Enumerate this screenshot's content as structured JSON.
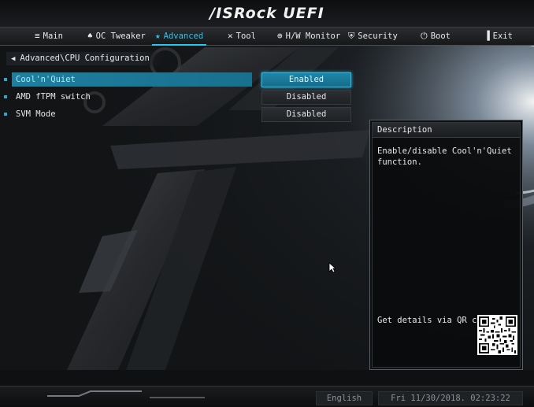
{
  "header": {
    "logo": "/ISRock UEFI"
  },
  "nav": {
    "tabs": [
      {
        "id": "main",
        "label": "Main",
        "icon": "list-icon",
        "glyph": "≡"
      },
      {
        "id": "oc",
        "label": "OC Tweaker",
        "icon": "rocket-icon",
        "glyph": "♠"
      },
      {
        "id": "advanced",
        "label": "Advanced",
        "icon": "star-icon",
        "glyph": "★"
      },
      {
        "id": "tool",
        "label": "Tool",
        "icon": "tools-icon",
        "glyph": "✕"
      },
      {
        "id": "hw",
        "label": "H/W Monitor",
        "icon": "monitor-icon",
        "glyph": "⊕"
      },
      {
        "id": "security",
        "label": "Security",
        "icon": "shield-icon",
        "glyph": "⛨"
      },
      {
        "id": "boot",
        "label": "Boot",
        "icon": "power-icon",
        "glyph": "⏻"
      },
      {
        "id": "exit",
        "label": "Exit",
        "icon": "exit-door-icon",
        "glyph": "▐"
      }
    ],
    "active": "Advanced"
  },
  "breadcrumb": {
    "path": "Advanced\\CPU Configuration"
  },
  "settings": [
    {
      "label": "Cool'n'Quiet",
      "value": "Enabled",
      "selected": true
    },
    {
      "label": "AMD fTPM switch",
      "value": "Disabled",
      "selected": false
    },
    {
      "label": "SVM Mode",
      "value": "Disabled",
      "selected": false
    }
  ],
  "description": {
    "title": "Description",
    "text": "Enable/disable Cool'n'Quiet function.",
    "qr_text": "Get details via QR code"
  },
  "footer": {
    "language": "English",
    "datetime": "Fri 11/30/2018. 02:23:22"
  },
  "colors": {
    "accent": "#27c8ef",
    "selected_row": "#1f7f9f"
  }
}
